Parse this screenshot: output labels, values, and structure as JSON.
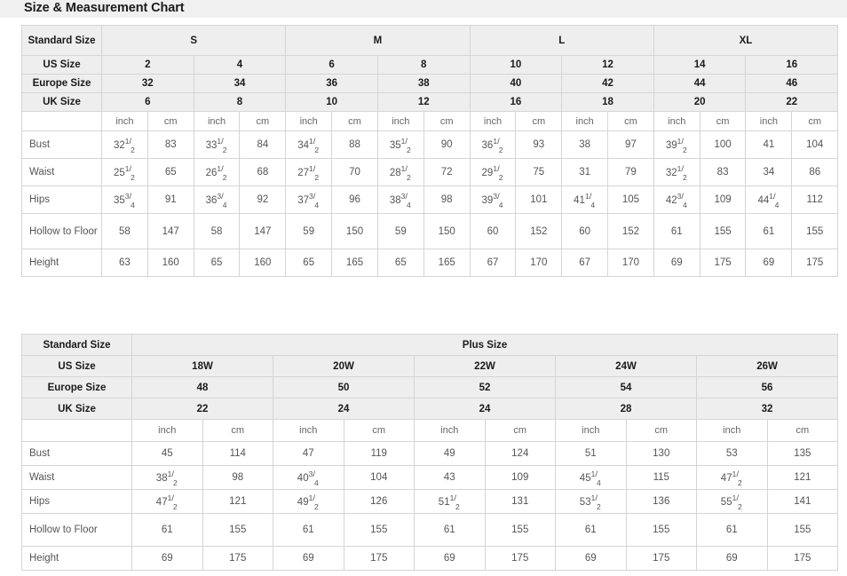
{
  "page": {
    "title": "Size & Measurement Chart",
    "accent_band_color": "#f0f0f0",
    "header_cell_color": "#eeeeee",
    "border_color": "#d5d5d5",
    "text_color": "#555555"
  },
  "standard_table": {
    "name": "Standard Size Chart",
    "corner_label": "Standard Size",
    "row_labels": {
      "us": "US Size",
      "europe": "Europe Size",
      "uk": "UK Size"
    },
    "groups": [
      {
        "label": "S",
        "span": 4
      },
      {
        "label": "M",
        "span": 4
      },
      {
        "label": "L",
        "span": 4
      },
      {
        "label": "XL",
        "span": 4
      }
    ],
    "us_sizes": [
      "2",
      "4",
      "6",
      "8",
      "10",
      "12",
      "14",
      "16"
    ],
    "europe_sizes": [
      "32",
      "34",
      "36",
      "38",
      "40",
      "42",
      "44",
      "46"
    ],
    "uk_sizes": [
      "6",
      "8",
      "10",
      "12",
      "16",
      "18",
      "20",
      "22"
    ],
    "unit_inch": "inch",
    "unit_cm": "cm",
    "measurements": [
      {
        "label": "Bust",
        "inch": [
          "32 1/2",
          "33 1/2",
          "34 1/2",
          "35 1/2",
          "36 1/2",
          "38",
          "39 1/2",
          "41"
        ],
        "cm": [
          "83",
          "84",
          "88",
          "90",
          "93",
          "97",
          "100",
          "104"
        ]
      },
      {
        "label": "Waist",
        "inch": [
          "25 1/2",
          "26 1/2",
          "27 1/2",
          "28 1/2",
          "29 1/2",
          "31",
          "32 1/2",
          "34"
        ],
        "cm": [
          "65",
          "68",
          "70",
          "72",
          "75",
          "79",
          "83",
          "86"
        ]
      },
      {
        "label": "Hips",
        "inch": [
          "35 3/4",
          "36 3/4",
          "37 3/4",
          "38 3/4",
          "39 3/4",
          "41 1/4",
          "42 3/4",
          "44 1/4"
        ],
        "cm": [
          "91",
          "92",
          "96",
          "98",
          "101",
          "105",
          "109",
          "112"
        ]
      },
      {
        "label": "Hollow to Floor",
        "inch": [
          "58",
          "58",
          "59",
          "59",
          "60",
          "60",
          "61",
          "61"
        ],
        "cm": [
          "147",
          "147",
          "150",
          "150",
          "152",
          "152",
          "155",
          "155"
        ]
      },
      {
        "label": "Height",
        "inch": [
          "63",
          "65",
          "65",
          "65",
          "67",
          "67",
          "69",
          "69"
        ],
        "cm": [
          "160",
          "160",
          "165",
          "165",
          "170",
          "170",
          "175",
          "175"
        ]
      }
    ]
  },
  "plus_table": {
    "name": "Plus Size Chart",
    "corner_label": "Standard Size",
    "group_label": "Plus Size",
    "row_labels": {
      "us": "US Size",
      "europe": "Europe Size",
      "uk": "UK Size"
    },
    "us_sizes": [
      "18W",
      "20W",
      "22W",
      "24W",
      "26W"
    ],
    "europe_sizes": [
      "48",
      "50",
      "52",
      "54",
      "56"
    ],
    "uk_sizes": [
      "22",
      "24",
      "24",
      "28",
      "32"
    ],
    "unit_inch": "inch",
    "unit_cm": "cm",
    "measurements": [
      {
        "label": "Bust",
        "inch": [
          "45",
          "47",
          "49",
          "51",
          "53"
        ],
        "cm": [
          "114",
          "119",
          "124",
          "130",
          "135"
        ]
      },
      {
        "label": "Waist",
        "inch": [
          "38 1/2",
          "40 3/4",
          "43",
          "45 1/4",
          "47 1/2"
        ],
        "cm": [
          "98",
          "104",
          "109",
          "115",
          "121"
        ]
      },
      {
        "label": "Hips",
        "inch": [
          "47 1/2",
          "49 1/2",
          "51 1/2",
          "53 1/2",
          "55 1/2"
        ],
        "cm": [
          "121",
          "126",
          "131",
          "136",
          "141"
        ]
      },
      {
        "label": "Hollow to Floor",
        "inch": [
          "61",
          "61",
          "61",
          "61",
          "61"
        ],
        "cm": [
          "155",
          "155",
          "155",
          "155",
          "155"
        ]
      },
      {
        "label": "Height",
        "inch": [
          "69",
          "69",
          "69",
          "69",
          "69"
        ],
        "cm": [
          "175",
          "175",
          "175",
          "175",
          "175"
        ]
      }
    ]
  }
}
